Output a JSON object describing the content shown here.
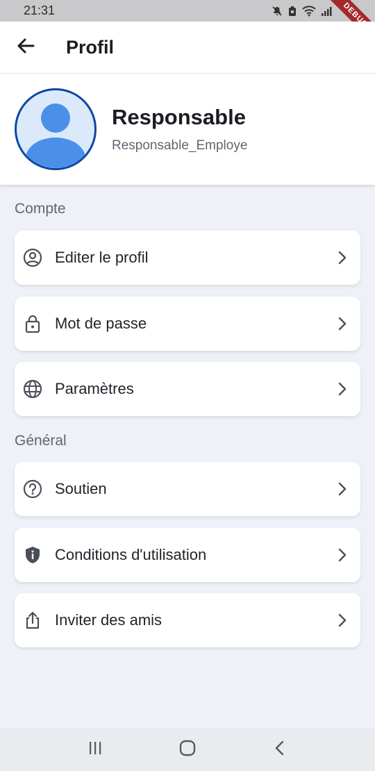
{
  "status_bar": {
    "time": "21:31",
    "icons": [
      "mute-icon",
      "battery-saver-icon",
      "wifi-icon",
      "signal-icon"
    ]
  },
  "debug_banner": {
    "label": "DEBUG"
  },
  "app_bar": {
    "title": "Profil",
    "back_icon": "arrow-left-icon"
  },
  "profile": {
    "name": "Responsable",
    "role": "Responsable_Employe",
    "avatar_icon": "person-icon"
  },
  "sections": [
    {
      "title": "Compte",
      "items": [
        {
          "label": "Editer le profil",
          "icon": "account-circle-icon"
        },
        {
          "label": "Mot de passe",
          "icon": "lock-icon"
        },
        {
          "label": "Paramètres",
          "icon": "globe-icon"
        }
      ]
    },
    {
      "title": "Général",
      "items": [
        {
          "label": "Soutien",
          "icon": "help-circle-icon"
        },
        {
          "label": "Conditions d'utilisation",
          "icon": "shield-info-icon"
        },
        {
          "label": "Inviter des amis",
          "icon": "share-icon"
        }
      ]
    }
  ],
  "colors": {
    "background": "#eef1f7",
    "card": "#ffffff",
    "avatar_border": "#0d47a1",
    "avatar_fill": "#dce9fb",
    "avatar_person": "#4a90e8",
    "debug": "#a5292c",
    "muted_text": "#5f6670"
  },
  "system_nav": [
    "recent-apps-icon",
    "home-icon",
    "back-icon"
  ]
}
